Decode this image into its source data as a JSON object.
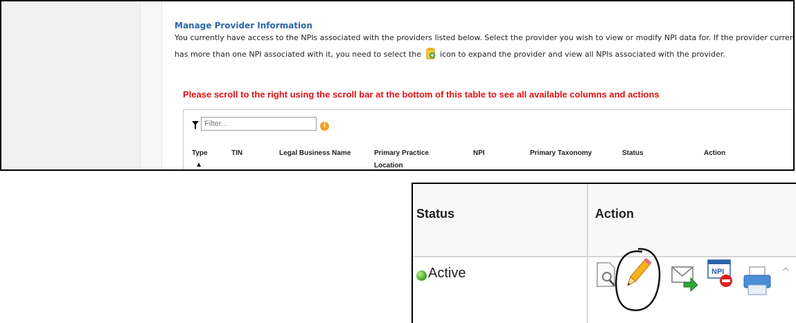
{
  "page": {
    "heading": "Manage Provider Information",
    "intro_line_1": "You currently have access to the NPIs associated with the providers listed below. Select the provider you wish to view or modify NPI data for. If the provider currentl",
    "intro_line_2_before": "has more than one NPI associated with it, you need to select the",
    "intro_line_2_after": "icon to expand the provider and view all NPIs associated with the provider.",
    "scroll_warning": "Please scroll to the right using the scroll bar at the bottom of this table to see all available columns and actions"
  },
  "filter": {
    "placeholder": "Filter..."
  },
  "table": {
    "columns": [
      {
        "label": "Type",
        "sorted": "ascending"
      },
      {
        "label": "TIN"
      },
      {
        "label": "Legal Business Name"
      },
      {
        "label": "Primary Practice\nLocation"
      },
      {
        "label": "NPI"
      },
      {
        "label": "Primary Taxonomy"
      },
      {
        "label": "Status"
      },
      {
        "label": "Action"
      }
    ],
    "sort_indicator": "▲"
  },
  "zoom": {
    "status_header": "Status",
    "action_header": "Action",
    "status_value": "Active",
    "status_color": "#3ba020",
    "action_icons": [
      "view-document-icon",
      "edit-pencil-icon",
      "send-email-icon",
      "deactivate-npi-icon",
      "print-icon"
    ],
    "highlighted_action": "edit-pencil-icon"
  }
}
